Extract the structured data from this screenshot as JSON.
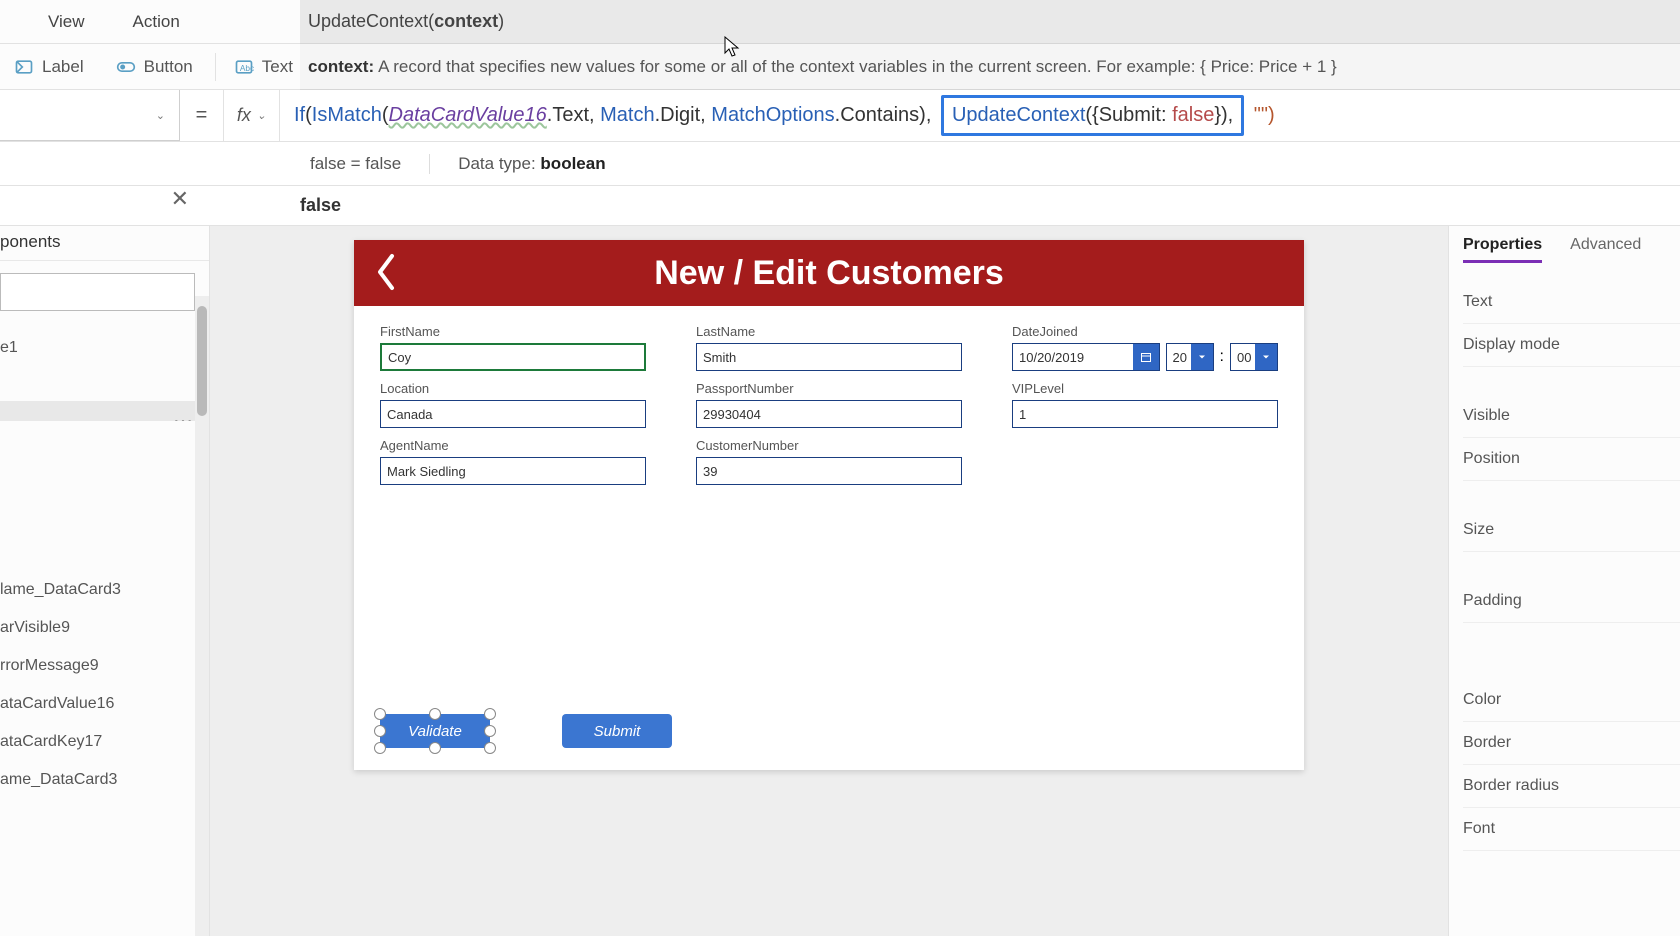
{
  "menu": {
    "view": "View",
    "action": "Action"
  },
  "ribbon": {
    "label": "Label",
    "button": "Button",
    "text": "Text"
  },
  "tooltip": {
    "sig": "UpdateContext(context)",
    "sig_prefix": "UpdateContext(",
    "sig_arg": "context",
    "sig_suffix": ")",
    "desc_label": "context:",
    "desc_text": "A record that specifies new values for some or all of the context variables in the current screen. For example: { Price: Price + 1 }"
  },
  "formula": {
    "equals": "=",
    "fx": "fx",
    "caret": "⌄",
    "If": "If",
    "open": "(",
    "IsMatch": "IsMatch",
    "open2": "(",
    "DataCardValue16": "DataCardValue16",
    "dotText": ".Text, ",
    "Match": "Match",
    "dotDigit": ".Digit, ",
    "MatchOptions": "MatchOptions",
    "dotContains": ".Contains",
    "close2": "),",
    "space": " ",
    "UpdateContext": "UpdateContext",
    "open3": "({",
    "Submit": "Submit: ",
    "false": "false",
    "close3": "}),",
    "empty": " \"\")"
  },
  "result": {
    "eval": "false  =  false",
    "type_label": "Data type: ",
    "type_val": "boolean",
    "value": "false"
  },
  "tree": {
    "header": "ponents",
    "item_e1": "e1",
    "selected": "",
    "items": [
      "lame_DataCard3",
      "arVisible9",
      "rrorMessage9",
      "ataCardValue16",
      "ataCardKey17",
      "ame_DataCard3"
    ]
  },
  "form": {
    "title": "New / Edit Customers",
    "fields": {
      "FirstName": {
        "label": "FirstName",
        "value": "Coy"
      },
      "LastName": {
        "label": "LastName",
        "value": "Smith"
      },
      "DateJoined": {
        "label": "DateJoined",
        "date": "10/20/2019",
        "hh": "20",
        "mm": "00"
      },
      "Location": {
        "label": "Location",
        "value": "Canada"
      },
      "PassportNumber": {
        "label": "PassportNumber",
        "value": "29930404"
      },
      "VIPLevel": {
        "label": "VIPLevel",
        "value": "1"
      },
      "AgentName": {
        "label": "AgentName",
        "value": "Mark Siedling"
      },
      "CustomerNumber": {
        "label": "CustomerNumber",
        "value": "39"
      }
    },
    "buttons": {
      "validate": "Validate",
      "submit": "Submit"
    }
  },
  "props": {
    "tab_properties": "Properties",
    "tab_advanced": "Advanced",
    "rows": {
      "Text": "Text",
      "DisplayMode": "Display mode",
      "Visible": "Visible",
      "Position": "Position",
      "Size": "Size",
      "Padding": "Padding",
      "Color": "Color",
      "Border": "Border",
      "BorderRadius": "Border radius",
      "Font": "Font"
    }
  }
}
